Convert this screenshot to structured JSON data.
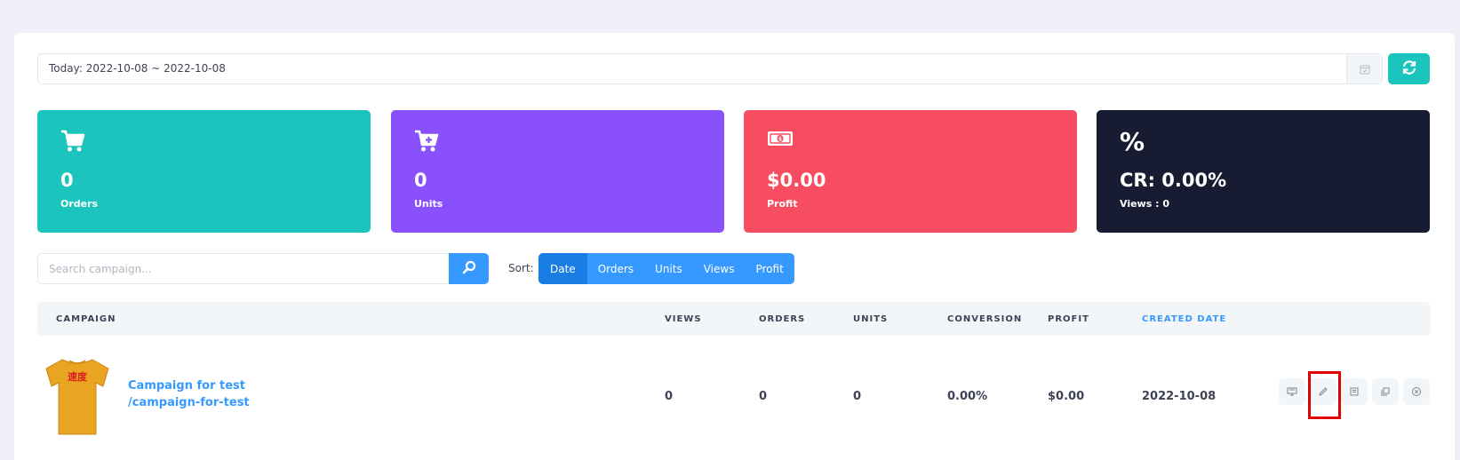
{
  "date_range": {
    "text": "Today: 2022-10-08 ~ 2022-10-08"
  },
  "stats": [
    {
      "value": "0",
      "label": "Orders",
      "icon": "cart-icon"
    },
    {
      "value": "0",
      "label": "Units",
      "icon": "cart-plus-icon"
    },
    {
      "value": "$0.00",
      "label": "Profit",
      "icon": "money-icon"
    },
    {
      "symbol": "%",
      "value": "CR: 0.00%",
      "label": "Views : 0",
      "icon": "percent-icon"
    }
  ],
  "search": {
    "placeholder": "Search campaign..."
  },
  "sort": {
    "label": "Sort:",
    "options": [
      "Date",
      "Orders",
      "Units",
      "Views",
      "Profit"
    ],
    "active": "Date"
  },
  "table": {
    "headers": [
      "CAMPAIGN",
      "VIEWS",
      "ORDERS",
      "UNITS",
      "CONVERSION",
      "PROFIT",
      "CREATED DATE"
    ],
    "sorted_column": "CREATED DATE",
    "rows": [
      {
        "title": "Campaign for test",
        "slug": "/campaign-for-test",
        "views": "0",
        "orders": "0",
        "units": "0",
        "conversion": "0.00%",
        "profit": "$0.00",
        "created": "2022-10-08"
      }
    ]
  },
  "colors": {
    "teal": "#1bc5bd",
    "purple": "#8950fc",
    "red": "#f64e60",
    "dark": "#181c32",
    "primary": "#3699ff",
    "highlight": "#e00000"
  }
}
